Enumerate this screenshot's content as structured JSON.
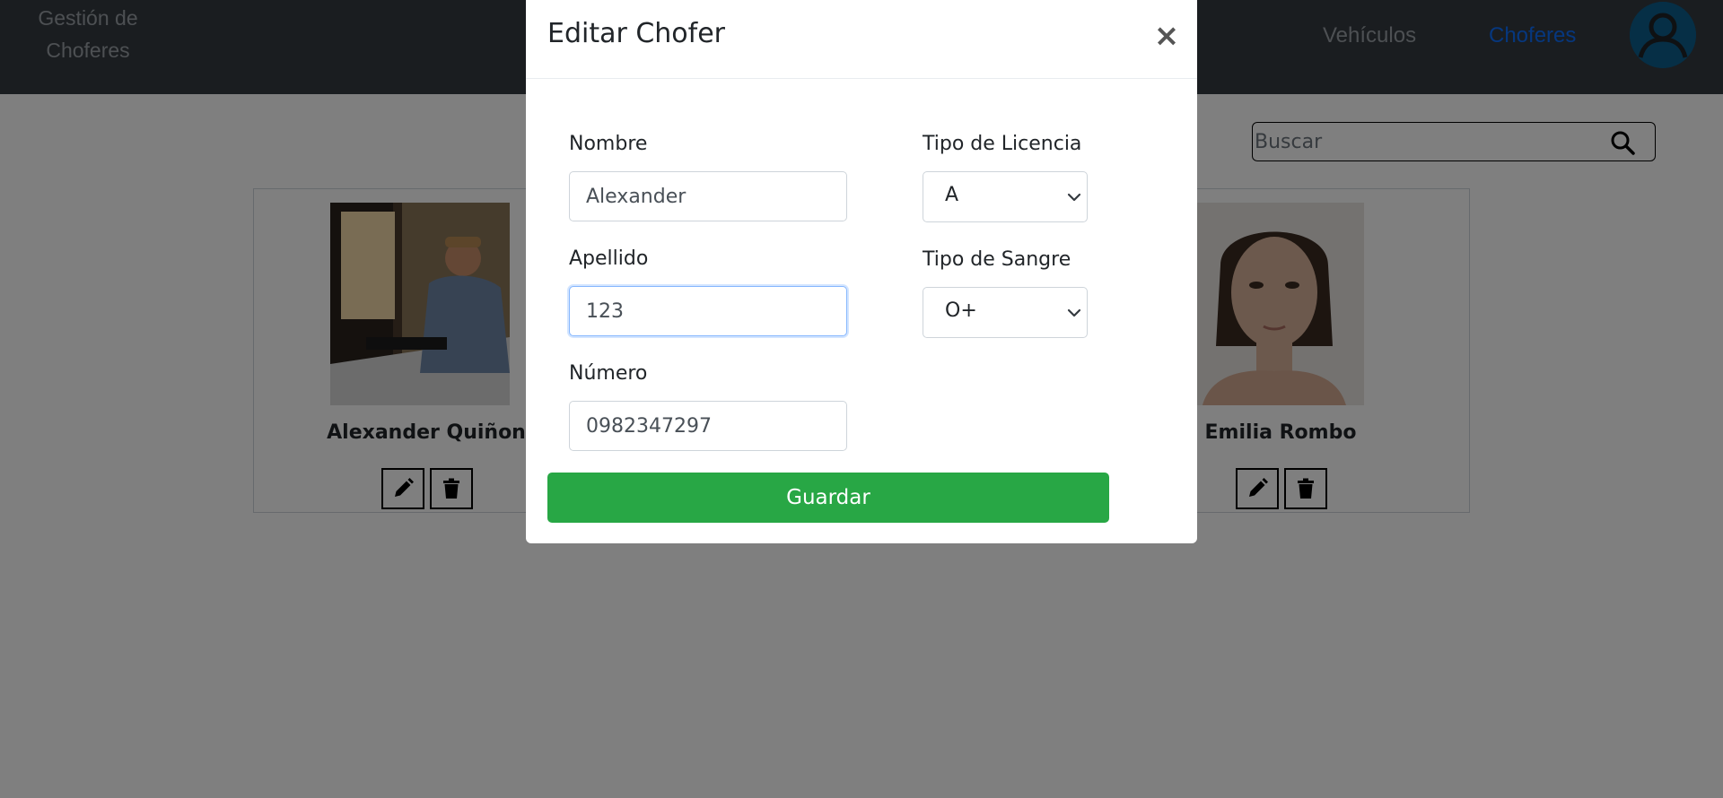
{
  "navbar": {
    "brand_line1": "Gestión de",
    "brand_line2": "Choferes",
    "links": [
      {
        "label": "Vehículos",
        "active": false
      },
      {
        "label": "Choferes",
        "active": true
      }
    ],
    "active_color": "#0d6efd",
    "avatar_icon": "user-circle-icon"
  },
  "search": {
    "placeholder": "Buscar",
    "icon": "search-icon"
  },
  "drivers": [
    {
      "name": "Alexander Quiñon"
    },
    {
      "name": "Emilia Rombo"
    }
  ],
  "modal": {
    "title": "Editar Chofer",
    "close_label": "×",
    "fields": {
      "nombre": {
        "label": "Nombre",
        "value": "Alexander"
      },
      "apellido": {
        "label": "Apellido",
        "value": "123"
      },
      "numero": {
        "label": "Número",
        "value": "0982347297"
      },
      "tipo_licencia": {
        "label": "Tipo de Licencia",
        "value": "A"
      },
      "tipo_sangre": {
        "label": "Tipo de Sangre",
        "value": "O+"
      }
    },
    "save_label": "Guardar",
    "save_color": "#28a745"
  }
}
